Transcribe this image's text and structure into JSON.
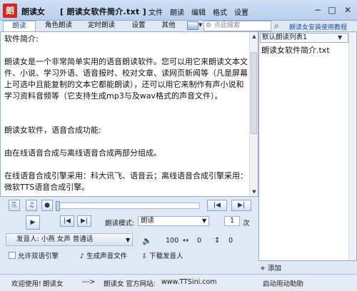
{
  "app": {
    "name": "朗读女",
    "logo_char": "朗",
    "file_title": "[ 朗读女软件简介.txt ]",
    "menus": [
      "文件",
      "朗读",
      "编辑",
      "格式",
      "设置"
    ],
    "window_controls": {
      "minimize": "−",
      "maximize": "□",
      "close": "✕"
    }
  },
  "toolbar": {
    "tabs": [
      "朗读",
      "角色朗读",
      "定时朗读",
      "设置",
      "其他"
    ],
    "active_tab_index": 0,
    "search_placeholder": "点此搜索",
    "help_link": "朗读女安装使用教程"
  },
  "editor": {
    "text": "软件简介:\n\n朗读女是一个非常简单实用的语音朗读软件。您可以用它来朗读文本文件、小说、学习外语、语音报时、校对文章、读网页新闻等（凡是屏幕上可选中且能复制的文本它都能朗读），还可以用它来制作有声小说和学习资料音频等（它支持生成mp3与及wav格式的声音文件）。\n\n\n朗读女软件，语音合成功能:\n\n由在线语音合成与离线语音合成两部分组成。\n\n在线语音合成引擎采用：科大讯飞、语音云；离线语音合成引擎采用：微软TTS语音合成引擎。"
  },
  "playlist": {
    "selected_list": "默认朗读列表1",
    "items": [
      "朗读女软件简介.txt"
    ],
    "add_label": "+ 添加"
  },
  "controls": {
    "progress_value": 0,
    "mode_label": "朗读模式:",
    "mode_value": "朗读",
    "repeat_count": "1",
    "repeat_unit": "次",
    "voice": "发音人: 小燕 女声 普通话",
    "volume": "100",
    "speed": "0",
    "pitch": "0",
    "dual_engine_label": "允许双语引擎",
    "generate_audio_label": "生成声音文件",
    "download_voice_label": "下载发音人"
  },
  "statusbar": {
    "welcome": "欢迎使用!",
    "app_name": "朗读女",
    "arrow": "--->",
    "site_label": "朗读女 官方网站:",
    "site_url": "www.TTSini.com",
    "autostart": "启动用动助助"
  },
  "colors": {
    "chrome": "#dfe8f5",
    "accent_blue": "#1a4ca5",
    "logo_red": "#d8261c"
  }
}
